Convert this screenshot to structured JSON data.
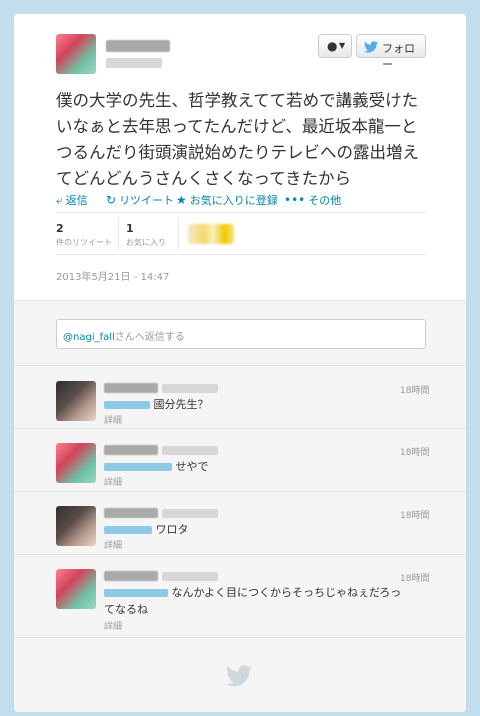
{
  "header": {
    "follow_label": "フォロー",
    "user_button_icon": "person-icon"
  },
  "tweet": {
    "text": "僕の大学の先生、哲学教えてて若めで講義受けたいなぁと去年思ってたんだけど、最近坂本龍一とつるんだり街頭演説始めたりテレビへの露出増えてどんどんうさんくさくなってきたから",
    "actions": {
      "reply": "返信",
      "retweet": "リツイート",
      "favorite": "お気に入りに登録",
      "more": "その他"
    },
    "stats": {
      "retweets_count": "2",
      "retweets_label": "件のリツイート",
      "favorites_count": "1",
      "favorites_label": "お気に入り"
    },
    "date": "2013年5月21日 - 14:47"
  },
  "reply_box": {
    "placeholder_mention": "@nagi_fall",
    "placeholder_rest": "さんへ返信する"
  },
  "replies": [
    {
      "text": "國分先生？",
      "time": "18時間",
      "detail": "詳細"
    },
    {
      "text": "せやで",
      "time": "18時間",
      "detail": "詳細"
    },
    {
      "text": "ワロタ",
      "time": "18時間",
      "detail": "詳細"
    },
    {
      "text": "なんかよく目につくからそっちじゃねぇだろってなるね",
      "time": "18時間",
      "detail": "詳細"
    }
  ],
  "colors": {
    "background": "#c0deed",
    "link": "#0084b4",
    "twitter_blue": "#55acee"
  }
}
